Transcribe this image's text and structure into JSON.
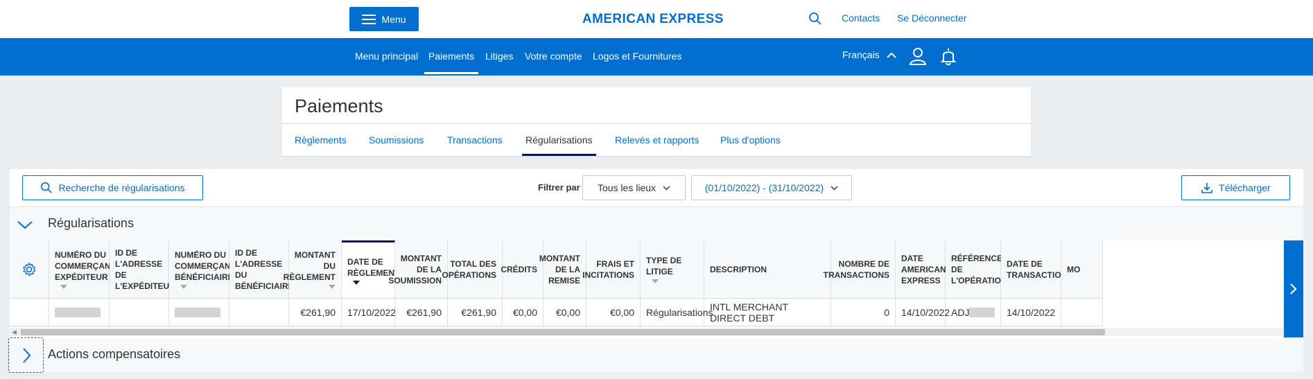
{
  "header": {
    "menu_label": "Menu",
    "logo": "AMERICAN EXPRESS",
    "contacts": "Contacts",
    "logout": "Se Déconnecter"
  },
  "nav": {
    "items": [
      "Menu principal",
      "Paiements",
      "Litiges",
      "Votre compte",
      "Logos et Fournitures"
    ],
    "active": "Paiements",
    "language": "Français"
  },
  "page": {
    "title": "Paiements",
    "tabs": [
      "Règlements",
      "Soumissions",
      "Transactions",
      "Régularisations",
      "Relevés et rapports",
      "Plus d'options"
    ],
    "active_tab": "Régularisations"
  },
  "toolbar": {
    "search_button": "Recherche de régularisations",
    "filter_label": "Filtrer par",
    "location_select": "Tous les lieux",
    "date_range": "(01/10/2022) - (31/10/2022)",
    "download_button": "Télécharger"
  },
  "section": {
    "title": "Régularisations",
    "expanded": true
  },
  "table": {
    "columns": [
      "Numéro du commerçant expéditeur",
      "ID de l'adresse de l'expéditeur",
      "Numéro du commerçant bénéficiaire",
      "ID de l'adresse du bénéficiaire",
      "Montant du règlement",
      "Date de règlement",
      "Montant de la soumission",
      "Total des opérations",
      "Crédits",
      "Montant de la remise",
      "Frais et incitations",
      "Type de litige",
      "Description",
      "Nombre de transactions",
      "Date American Express",
      "Référence de l'opération",
      "Date de transaction",
      "Mo"
    ],
    "sorted_column": "Date de règlement",
    "rows": [
      {
        "sender_merchant": "",
        "sender_address_id": "",
        "beneficiary_merchant": "",
        "beneficiary_address_id": "",
        "settlement_amount": "€261,90",
        "settlement_date": "17/10/2022",
        "submission_amount": "€261,90",
        "total_operations": "€261,90",
        "credits": "€0,00",
        "discount_amount": "€0,00",
        "fees": "€0,00",
        "dispute_type": "Régularisations",
        "description": "INTL MERCHANT DIRECT DEBT",
        "transaction_count": "0",
        "amex_date": "14/10/2022",
        "operation_reference": "ADJ",
        "transaction_date": "14/10/2022"
      }
    ]
  },
  "section2": {
    "title": "Actions compensatoires",
    "expanded": false
  },
  "colors": {
    "brand_blue": "#006fcf",
    "dark_navy": "#00175a"
  }
}
